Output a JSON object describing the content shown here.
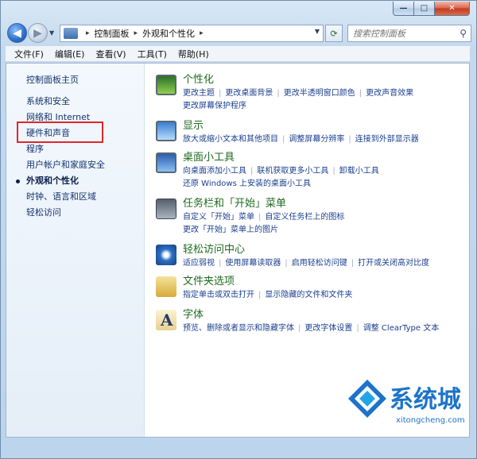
{
  "window": {
    "minimize_glyph": "—",
    "maximize_glyph": "□",
    "close_glyph": "✕"
  },
  "address": {
    "crumbs": [
      "控制面板",
      "外观和个性化"
    ],
    "separator": "▸",
    "search_placeholder": "搜索控制面板"
  },
  "menu": [
    "文件(F)",
    "编辑(E)",
    "查看(V)",
    "工具(T)",
    "帮助(H)"
  ],
  "sidebar": {
    "home": "控制面板主页",
    "items": [
      "系统和安全",
      "网络和 Internet",
      "硬件和声音",
      "程序",
      "用户帐户和家庭安全",
      "外观和个性化",
      "时钟、语言和区域",
      "轻松访问"
    ],
    "active_index": 5,
    "highlighted_item": "硬件和声音"
  },
  "categories": [
    {
      "title": "个性化",
      "icon": "personalization-icon",
      "links": [
        "更改主题",
        "更改桌面背景",
        "更改半透明窗口颜色",
        "更改声音效果",
        "更改屏幕保护程序"
      ]
    },
    {
      "title": "显示",
      "icon": "display-icon",
      "links": [
        "放大或缩小文本和其他项目",
        "调整屏幕分辨率",
        "连接到外部显示器"
      ]
    },
    {
      "title": "桌面小工具",
      "icon": "gadgets-icon",
      "links": [
        "向桌面添加小工具",
        "联机获取更多小工具",
        "卸载小工具",
        "还原 Windows 上安装的桌面小工具"
      ]
    },
    {
      "title": "任务栏和「开始」菜单",
      "icon": "taskbar-icon",
      "links": [
        "自定义「开始」菜单",
        "自定义任务栏上的图标",
        "更改「开始」菜单上的图片"
      ]
    },
    {
      "title": "轻松访问中心",
      "icon": "ease-of-access-icon",
      "links": [
        "适应弱视",
        "使用屏幕读取器",
        "启用轻松访问键",
        "打开或关闭高对比度"
      ]
    },
    {
      "title": "文件夹选项",
      "icon": "folder-options-icon",
      "links": [
        "指定单击或双击打开",
        "显示隐藏的文件和文件夹"
      ]
    },
    {
      "title": "字体",
      "icon": "fonts-icon",
      "links": [
        "预览、删除或者显示和隐藏字体",
        "更改字体设置",
        "调整 ClearType 文本"
      ]
    }
  ],
  "watermark": {
    "brand": "系统城",
    "url": "xitongcheng.com"
  },
  "colors": {
    "category_title": "#1e6b1e",
    "link": "#1b3f8f",
    "highlight_box": "#e0272b",
    "watermark": "#1c73c9"
  }
}
